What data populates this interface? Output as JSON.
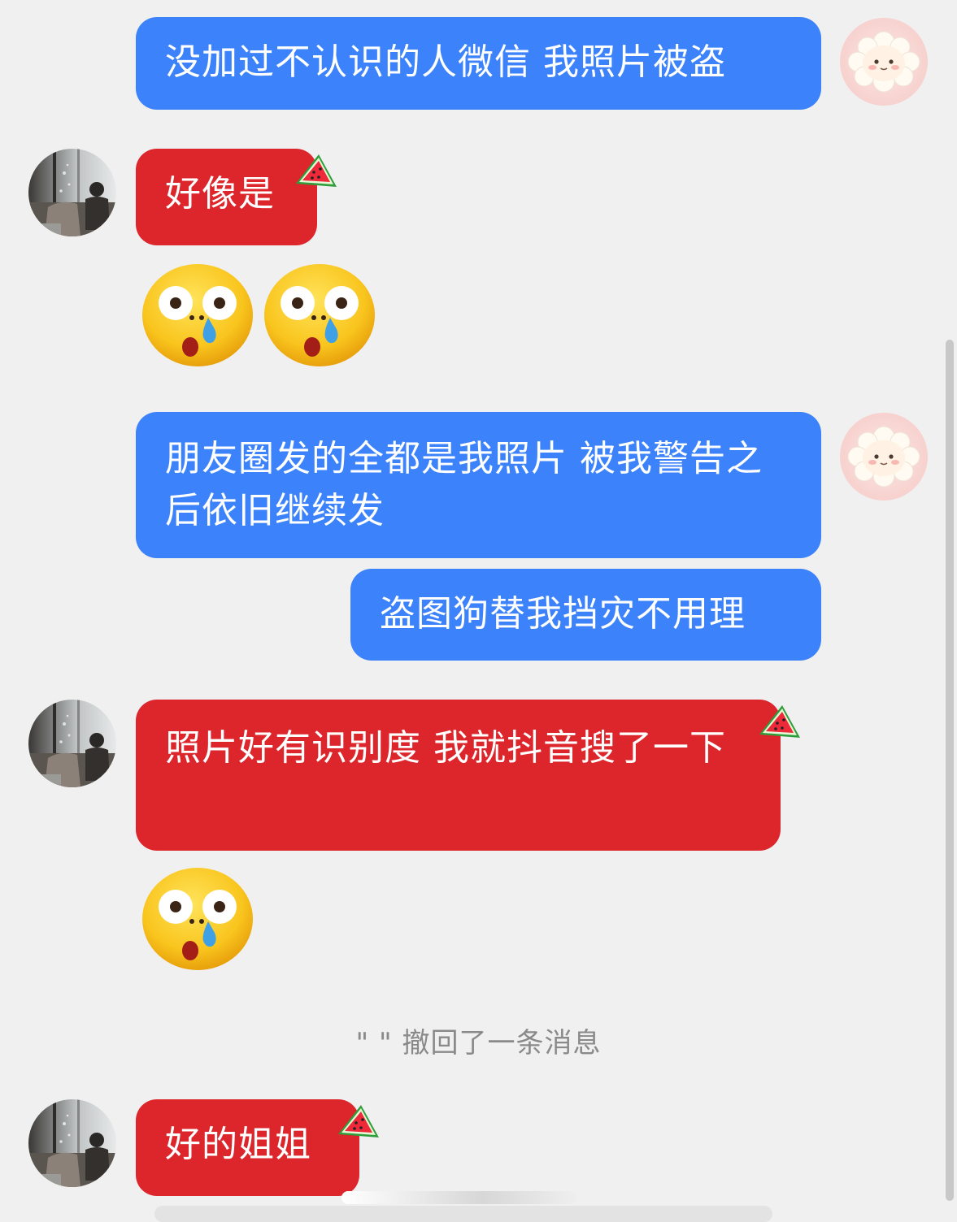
{
  "chat": {
    "messages": [
      {
        "sender": "me",
        "text": "没加过不认识的人微信 我照片被盗"
      },
      {
        "sender": "other",
        "text": "好像是"
      },
      {
        "sender": "me",
        "text": "朋友圈发的全都是我照片 被我警告之后依旧继续发"
      },
      {
        "sender": "me",
        "text": "盗图狗替我挡灾不用理"
      },
      {
        "sender": "other",
        "text": "照片好有识别度 我就抖音搜了一下"
      },
      {
        "sender": "other",
        "text": "好的姐姐"
      }
    ],
    "system_notice": "\" \" 撤回了一条消息"
  },
  "colors": {
    "background": "#f0f0f0",
    "my_bubble": "#3c82fb",
    "other_bubble": "#dc262c",
    "system_text": "#8a8a8a"
  },
  "icons": {
    "my_avatar": "sheep-avatar-icon",
    "other_avatar": "window-person-avatar-icon",
    "emoji": "shocked-crying-emoji-icon",
    "sticker": "watermelon-icon"
  }
}
